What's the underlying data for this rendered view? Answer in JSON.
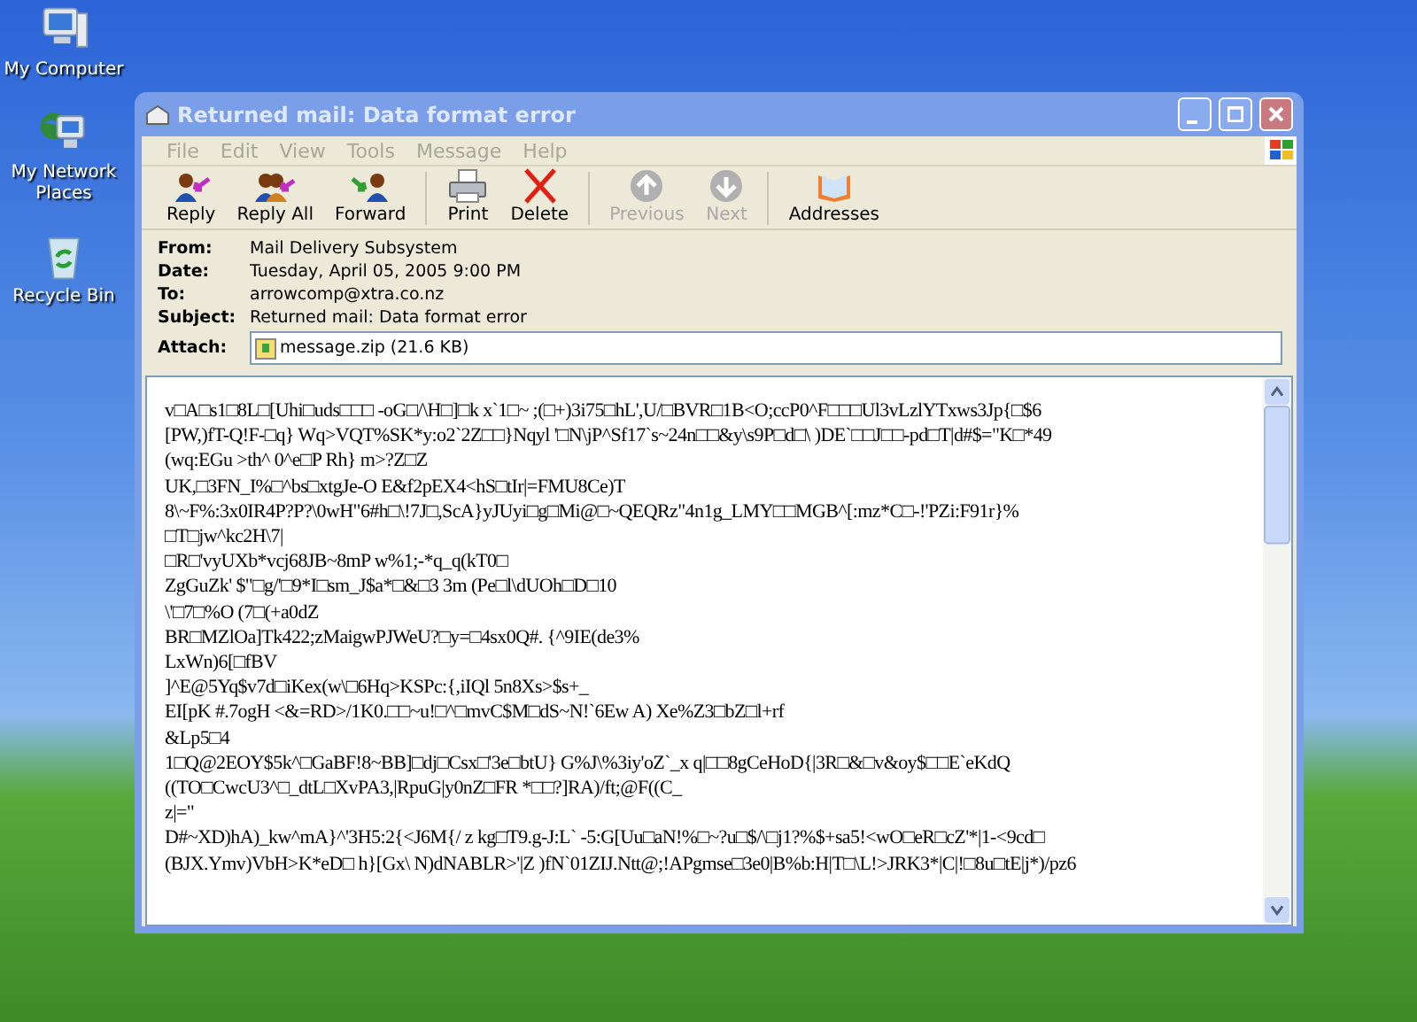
{
  "desktop_icons": [
    {
      "label": "My Computer",
      "kind": "computer"
    },
    {
      "label": "My Network Places",
      "kind": "network"
    },
    {
      "label": "Recycle Bin",
      "kind": "bin"
    }
  ],
  "window": {
    "title": "Returned mail: Data format error",
    "menu": [
      "File",
      "Edit",
      "View",
      "Tools",
      "Message",
      "Help"
    ],
    "toolbar": [
      {
        "label": "Reply",
        "kind": "reply",
        "disabled": false
      },
      {
        "label": "Reply All",
        "kind": "replyall",
        "disabled": false
      },
      {
        "label": "Forward",
        "kind": "forward",
        "disabled": false
      },
      {
        "label": "Print",
        "kind": "print",
        "disabled": false
      },
      {
        "label": "Delete",
        "kind": "delete",
        "disabled": false
      },
      {
        "label": "Previous",
        "kind": "previous",
        "disabled": true
      },
      {
        "label": "Next",
        "kind": "next",
        "disabled": true
      },
      {
        "label": "Addresses",
        "kind": "addresses",
        "disabled": false
      }
    ],
    "headers": [
      {
        "label": "From:",
        "value": "Mail Delivery Subsystem"
      },
      {
        "label": "Date:",
        "value": "Tuesday, April 05, 2005 9:00 PM"
      },
      {
        "label": "To:",
        "value": "arrowcomp@xtra.co.nz"
      },
      {
        "label": "Subject:",
        "value": "Returned mail: Data format error"
      }
    ],
    "attachment": {
      "label": "Attach:",
      "file": "message.zip (21.6 KB)"
    },
    "body_lines": [
      "v□A□s1□8L□[Uhi□uds□□□ -oG□/\\H□]□k x`1□~ ;(□+)3i75□hL',U/□BVR□1B<O;ccP0^F□□□Ul3vLzlYTxws3Jp{□$6",
      "[PW,)fT-Q!F-□q} Wq>VQT%SK*y:o2`2Z□□}Nqyl '□N\\jP^Sf17`s~24n□□&y\\s9P□d□\\ )DE`□□J□□-pd□T|d#$=\"K□*49",
      "(wq:EGu >th^ 0^e□P Rh} m>?Z□Z",
      "UK,□3FN_I%□^bs□xtgJe-O E&f2pEX4<hS□tIr|=FMU8Ce)T",
      "8\\~F%:3x0IR4P?P?\\0wH\"6#h□\\!7J□,ScA}yJUyi□g□Mi@□~QEQRz\"4n1g_LMY□□MGB^[:mz*C□-!'PZi:F91r}%",
      "□T□jw^kc2H\\7|",
      "□R□'vyUXb*vcj68JB~8mP w%1;-*q_q(kT0□",
      "ZgGuZk' $\"□g/'□9*I□sm_J$a*□&□3 3m (Pe□l\\dUOh□D□10",
      "\\'□7□%O (7□(+a0dZ",
      "BR□MZlOa]Tk422;zMaigwPJWeU?□y=□4sx0Q#. {^9IE(de3%",
      "LxWn)6[□fBV",
      "]^E@5Yq$v7d□iKex(w\\□6Hq>KSPc:{,iIQl 5n8Xs>$s+_",
      "EI[pK #.7ogH <&=RD>/1K0.□□~u!□^□mvC$M□dS~N!`6Ew A) Xe%Z3□bZ□l+rf",
      "&Lp5□4",
      "1□Q@2EOY$5k^□GaBF!8~BB]□dj□Csx□'3e□btU} G%J\\%3iy'oZ`_x q|□□8gCeHoD{|3R□&□v&oy$□□E`eKdQ",
      "((TO□CwcU3^□_dtL□XvPA3,|RpuG|y0nZ□FR *□□?]RA)/ft;@F((C_",
      "z|=\"",
      "D#~XD)hA)_kw^mA}^'3H5:2{<J6M{/ z kg□T9.g-J:L` -5:G[Uu□aN!%□~?u□$/\\□j1?%$+sa5!<wO□eR□cZ'*|1-<9cd□",
      "(BJX.Ymv)VbH>K*eD□ h}[Gx\\ N)dNABLR>'|Z )fN`01ZIJ.Ntt@;!APgmse□3e0|B%b:H|T□\\L!>JRK3*|C|!□8u□tE|j*)/pz6"
    ]
  }
}
